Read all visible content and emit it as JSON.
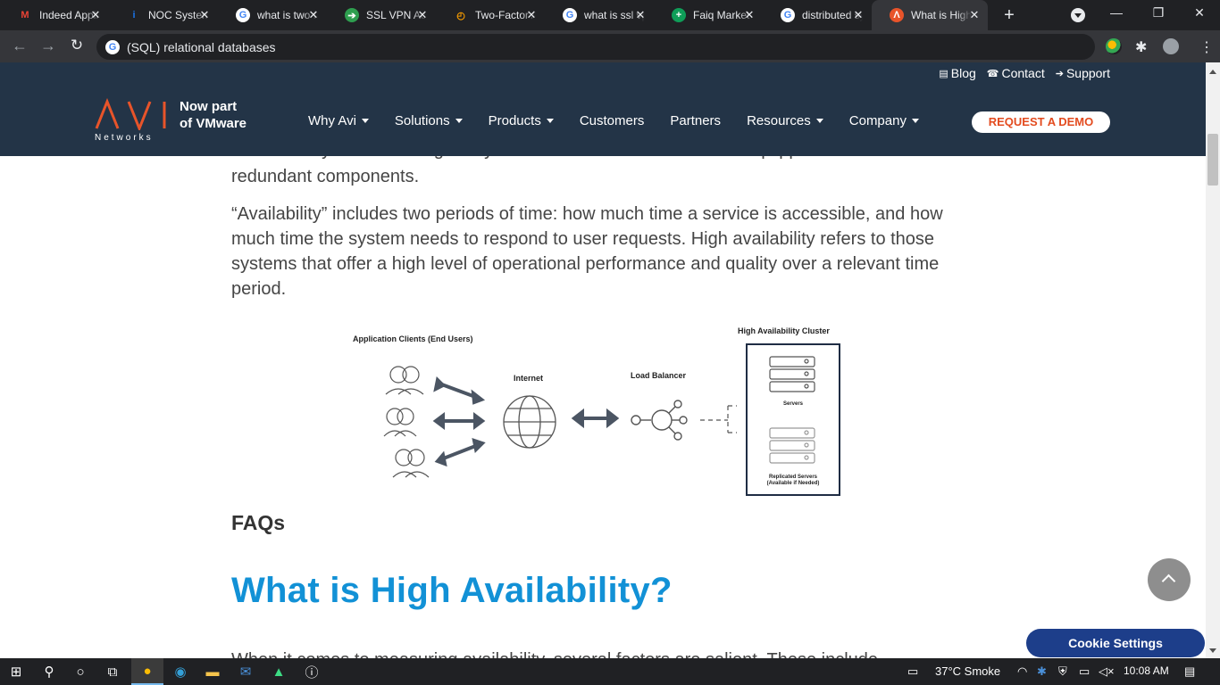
{
  "browser": {
    "tabs": [
      {
        "title": "Indeed Applications",
        "icon": "gmail-icon",
        "glyph": "M",
        "color": "#ea4335",
        "bg": "transparent"
      },
      {
        "title": "NOC System Engineer",
        "icon": "info-icon",
        "glyph": "i",
        "color": "#1a73e8",
        "bg": "transparent"
      },
      {
        "title": "what is two factor",
        "icon": "google-icon",
        "glyph": "G",
        "color": "#4285f4",
        "bg": "#ffffff"
      },
      {
        "title": "SSL VPN Access",
        "icon": "arrow-box-icon",
        "glyph": "➔",
        "color": "#ffffff",
        "bg": "#2e9e4f"
      },
      {
        "title": "Two-Factor Authentication",
        "icon": "two-factor-icon",
        "glyph": "◴",
        "color": "#f29900",
        "bg": "transparent"
      },
      {
        "title": "what is ssl vpn",
        "icon": "google-icon",
        "glyph": "G",
        "color": "#4285f4",
        "bg": "#ffffff"
      },
      {
        "title": "Faiq Market Sheet",
        "icon": "sheets-icon",
        "glyph": "+",
        "color": "#ffffff",
        "bg": "#0f9d58"
      },
      {
        "title": "distributed systems",
        "icon": "google-icon",
        "glyph": "G",
        "color": "#4285f4",
        "bg": "#ffffff"
      },
      {
        "title": "What is High Availability",
        "icon": "avi-icon",
        "glyph": "Λ",
        "color": "#ffffff",
        "bg": "#e8542a",
        "active": true
      }
    ],
    "new_tab": "+",
    "address": "(SQL) relational databases",
    "window_controls": {
      "minimize": "—",
      "restore": "❐",
      "close": "✕"
    }
  },
  "site": {
    "top_links": [
      {
        "icon": "newspaper-icon",
        "glyph": "▤",
        "label": "Blog"
      },
      {
        "icon": "phone-icon",
        "glyph": "☎",
        "label": "Contact"
      },
      {
        "icon": "login-icon",
        "glyph": "➔",
        "label": "Support"
      }
    ],
    "logo": {
      "brand": "AVI",
      "sub": "Networks",
      "tag_line1": "Now part",
      "tag_line2": "of VMware"
    },
    "menu": [
      {
        "label": "Why Avi",
        "dropdown": true
      },
      {
        "label": "Solutions",
        "dropdown": true
      },
      {
        "label": "Products",
        "dropdown": true
      },
      {
        "label": "Customers",
        "dropdown": false
      },
      {
        "label": "Partners",
        "dropdown": false
      },
      {
        "label": "Resources",
        "dropdown": true
      },
      {
        "label": "Company",
        "dropdown": true
      }
    ],
    "cta": "REQUEST A DEMO",
    "accent": "#e34b1f",
    "nav_bg": "#233447"
  },
  "article": {
    "para_cut": "continuously without failing. They are well-tested and sometimes equipped with",
    "para_one_end": "redundant components.",
    "para_two": "“Availability” includes two periods of time: how much time a service is accessible, and how much time the system needs to respond to user requests. High availability refers to those systems that offer a high level of operational performance and quality over a relevant time period.",
    "diagram": {
      "clients": "Application Clients (End Users)",
      "internet": "Internet",
      "load_balancer": "Load Balancer",
      "cluster": "High Availability Cluster",
      "servers": "Servers",
      "replicated_1": "Replicated Servers",
      "replicated_2": "(Available if Needed)"
    },
    "faqs": "FAQs",
    "heading": "What is High Availability?",
    "para_bottom": "When it comes to measuring availability, several factors are salient. These include"
  },
  "floating": {
    "cookie": "Cookie Settings"
  },
  "taskbar": {
    "weather": "37°C  Smoke",
    "time": "10:08 AM"
  }
}
